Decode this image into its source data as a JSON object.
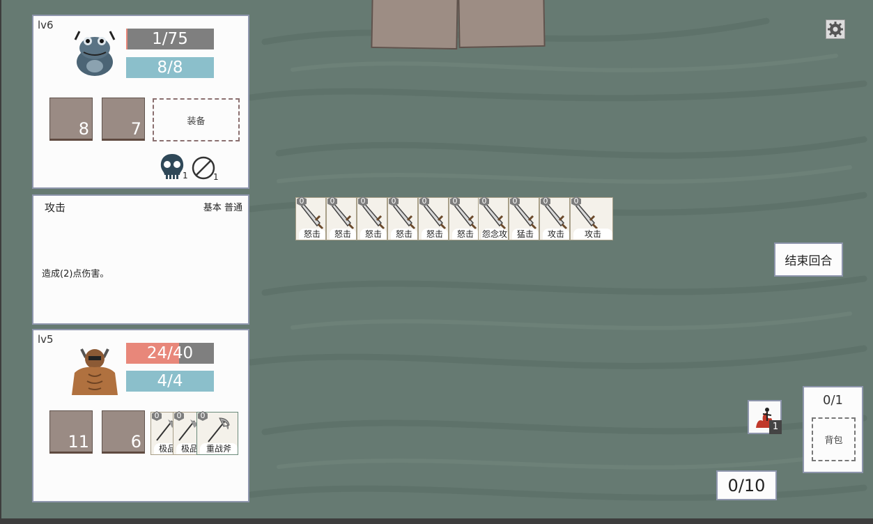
{
  "player": {
    "level": "lv6",
    "hp": "1/75",
    "hp_fraction": 0.0133,
    "mp": "8/8",
    "mp_fraction": 1,
    "slot1": "8",
    "slot2": "7",
    "equip_label": "装备",
    "status": [
      {
        "icon": "skull-icon",
        "count": "1"
      },
      {
        "icon": "no-entry-icon",
        "count": "1"
      }
    ]
  },
  "description": {
    "title": "攻击",
    "tags": "基本 普通",
    "text": "造成(2)点伤害。"
  },
  "enemy": {
    "level": "lv5",
    "hp": "24/40",
    "hp_fraction": 0.6,
    "mp": "4/4",
    "mp_fraction": 1,
    "slot1": "11",
    "slot2": "6",
    "cards": [
      {
        "cost": "0",
        "name": "极品"
      },
      {
        "cost": "0",
        "name": "极品"
      },
      {
        "cost": "0",
        "name": "重战斧"
      }
    ]
  },
  "hand": [
    {
      "cost": "0",
      "name": "怒击"
    },
    {
      "cost": "0",
      "name": "怒击"
    },
    {
      "cost": "0",
      "name": "怒击"
    },
    {
      "cost": "0",
      "name": "怒击"
    },
    {
      "cost": "0",
      "name": "怒击"
    },
    {
      "cost": "0",
      "name": "怒击"
    },
    {
      "cost": "0",
      "name": "怨念攻"
    },
    {
      "cost": "0",
      "name": "猛击"
    },
    {
      "cost": "0",
      "name": "攻击"
    },
    {
      "cost": "0",
      "name": "攻击"
    }
  ],
  "end_turn_label": "结束回合",
  "buff_count": "1",
  "backpack": {
    "count": "0/1",
    "label": "背包"
  },
  "energy": "0/10",
  "colors": {
    "background": "#667a72",
    "hp_fill": "#e8877a",
    "hp_empty": "#7f7f7f",
    "mp_fill": "#8bbfcb",
    "panel_border": "#8e96ad"
  }
}
